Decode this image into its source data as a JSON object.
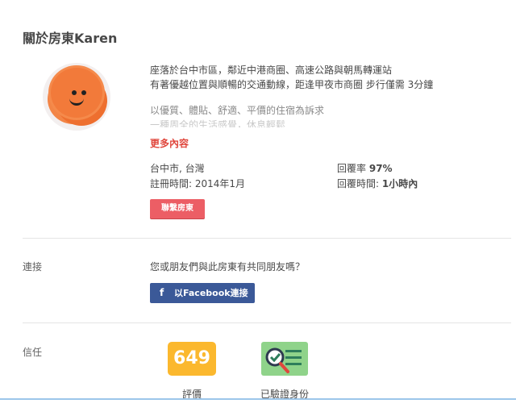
{
  "header": {
    "title": "關於房東Karen"
  },
  "description": {
    "line1": "座落於台中市區，鄰近中港商圈、高速公路與朝馬轉運站",
    "line2": "有著優越位置與順暢的交通動線，距逢甲夜市商圈 步行僅需 3分鐘",
    "line3": "以優質、體貼、舒適、平價的住宿為訴求",
    "line4": "一種周全的生活感覺，休息輕鬆",
    "more_link": "更多內容"
  },
  "host_info": {
    "location": "台中市, 台灣",
    "registered": "註冊時間: 2014年1月",
    "response_rate_label": "回覆率",
    "response_rate_value": "97%",
    "response_time_label": "回覆時間:",
    "response_time_value": "1小時內",
    "contact_button": "聯繫房東"
  },
  "connection": {
    "label": "連接",
    "question": "您或朋友們與此房東有共同朋友嗎？",
    "facebook_icon": "f",
    "facebook_button": "以Facebook連接"
  },
  "trust": {
    "label": "信任",
    "reviews_count": "649",
    "reviews_label": "評價",
    "verified_label": "已驗證身份",
    "verified_icon": "id-check-icon"
  },
  "colors": {
    "accent_red": "#e0473d",
    "contact_button": "#ec5e65",
    "facebook": "#3b5998",
    "review_badge": "#fbb82e",
    "verified_card": "#8fd38a"
  }
}
